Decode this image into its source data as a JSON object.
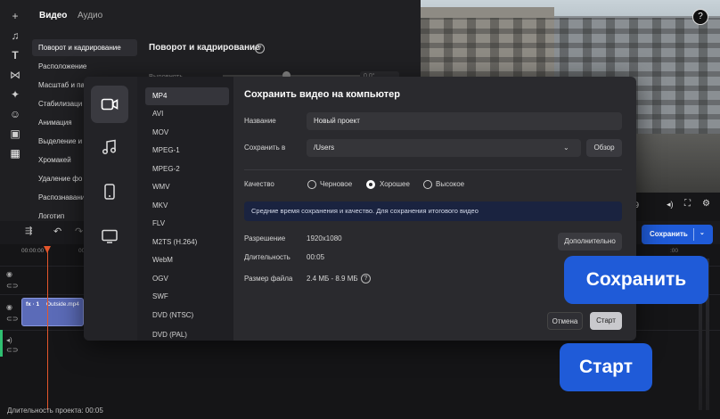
{
  "panel": {
    "tabs": [
      "Видео",
      "Аудио"
    ],
    "menu": [
      "Поворот и кадрирование",
      "Расположение",
      "Масштаб и па",
      "Стабилизаци",
      "Анимация",
      "Выделение и",
      "Хромакей",
      "Удаление фо",
      "Распознавани",
      "Логотип"
    ],
    "title": "Поворот и кадрирование",
    "slider_label": "Выровнять",
    "slider_value": "0.0°"
  },
  "timeline": {
    "timecode": "00:00:00",
    "clip_fx": "fx · 1",
    "clip_name": "Outside.mp4",
    "duration_label": "Длительность проекта: 00:05"
  },
  "toolbar": {
    "save_label": "Сохранить"
  },
  "dialog": {
    "title": "Сохранить видео на компьютер",
    "formats": [
      "MP4",
      "AVI",
      "MOV",
      "MPEG-1",
      "MPEG-2",
      "WMV",
      "MKV",
      "FLV",
      "M2TS (H.264)",
      "WebM",
      "OGV",
      "SWF",
      "DVD (NTSC)",
      "DVD (PAL)"
    ],
    "name_label": "Название",
    "name_value": "Новый проект",
    "save_in_label": "Сохранить в",
    "path_value": "/Users",
    "browse_label": "Обзор",
    "quality_label": "Качество",
    "quality_options": [
      "Черновое",
      "Хорошее",
      "Высокое"
    ],
    "quality_selected": "Хорошее",
    "info": "Средние время сохранения и качество. Для сохранения итогового видео",
    "resolution_label": "Разрешение",
    "resolution_value": "1920x1080",
    "advanced_label": "Дополнительно",
    "duration_label": "Длительность",
    "duration_value": "00:05",
    "filesize_label": "Размер файла",
    "filesize_value": "2.4 МБ - 8.9 МБ",
    "cancel_label": "Отмена",
    "start_label": "Старт"
  },
  "callouts": {
    "save": "Сохранить",
    "start": "Старт"
  },
  "colors": {
    "accent": "#1f5bd8",
    "playhead": "#e4562b",
    "clip": "#5b6bb8"
  }
}
